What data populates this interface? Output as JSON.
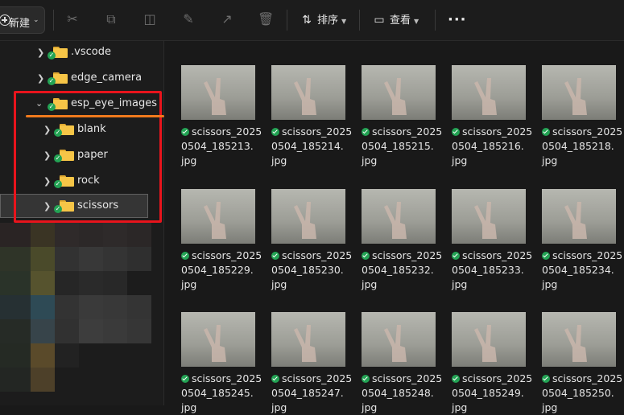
{
  "toolbar": {
    "new_label": "新建",
    "sort_label": "排序",
    "view_label": "查看",
    "icons": [
      "cut-icon",
      "copy-icon",
      "paste-icon",
      "rename-icon",
      "share-icon",
      "delete-icon"
    ]
  },
  "sidebar": {
    "items": [
      {
        "label": ".vscode",
        "level": 1,
        "expanded": false
      },
      {
        "label": "edge_camera",
        "level": 1,
        "expanded": false
      },
      {
        "label": "esp_eye_images",
        "level": 1,
        "expanded": true
      },
      {
        "label": "blank",
        "level": 2,
        "expanded": false
      },
      {
        "label": "paper",
        "level": 2,
        "expanded": false
      },
      {
        "label": "rock",
        "level": 2,
        "expanded": false
      },
      {
        "label": "scissors",
        "level": 2,
        "expanded": false,
        "selected": true
      }
    ]
  },
  "files": [
    {
      "line1": "scissors_2025",
      "line2": "0504_185213.",
      "line3": "jpg"
    },
    {
      "line1": "scissors_2025",
      "line2": "0504_185214.",
      "line3": "jpg"
    },
    {
      "line1": "scissors_2025",
      "line2": "0504_185215.",
      "line3": "jpg"
    },
    {
      "line1": "scissors_2025",
      "line2": "0504_185216.",
      "line3": "jpg"
    },
    {
      "line1": "scissors_2025",
      "line2": "0504_185218.",
      "line3": "jpg"
    },
    {
      "line1": "scissors_2025",
      "line2": "0504_185229.",
      "line3": "jpg"
    },
    {
      "line1": "scissors_2025",
      "line2": "0504_185230.",
      "line3": "jpg"
    },
    {
      "line1": "scissors_2025",
      "line2": "0504_185232.",
      "line3": "jpg"
    },
    {
      "line1": "scissors_2025",
      "line2": "0504_185233.",
      "line3": "jpg"
    },
    {
      "line1": "scissors_2025",
      "line2": "0504_185234.",
      "line3": "jpg"
    },
    {
      "line1": "scissors_2025",
      "line2": "0504_185245.",
      "line3": "jpg"
    },
    {
      "line1": "scissors_2025",
      "line2": "0504_185247.",
      "line3": "jpg"
    },
    {
      "line1": "scissors_2025",
      "line2": "0504_185248.",
      "line3": "jpg"
    },
    {
      "line1": "scissors_2025",
      "line2": "0504_185249.",
      "line3": "jpg"
    },
    {
      "line1": "scissors_2025",
      "line2": "0504_185250.",
      "line3": "jpg"
    }
  ],
  "colors": {
    "highlight_box": "#e8141c",
    "underline": "#f07a1d",
    "sync_ok": "#23a354",
    "folder": "#f6c547"
  }
}
